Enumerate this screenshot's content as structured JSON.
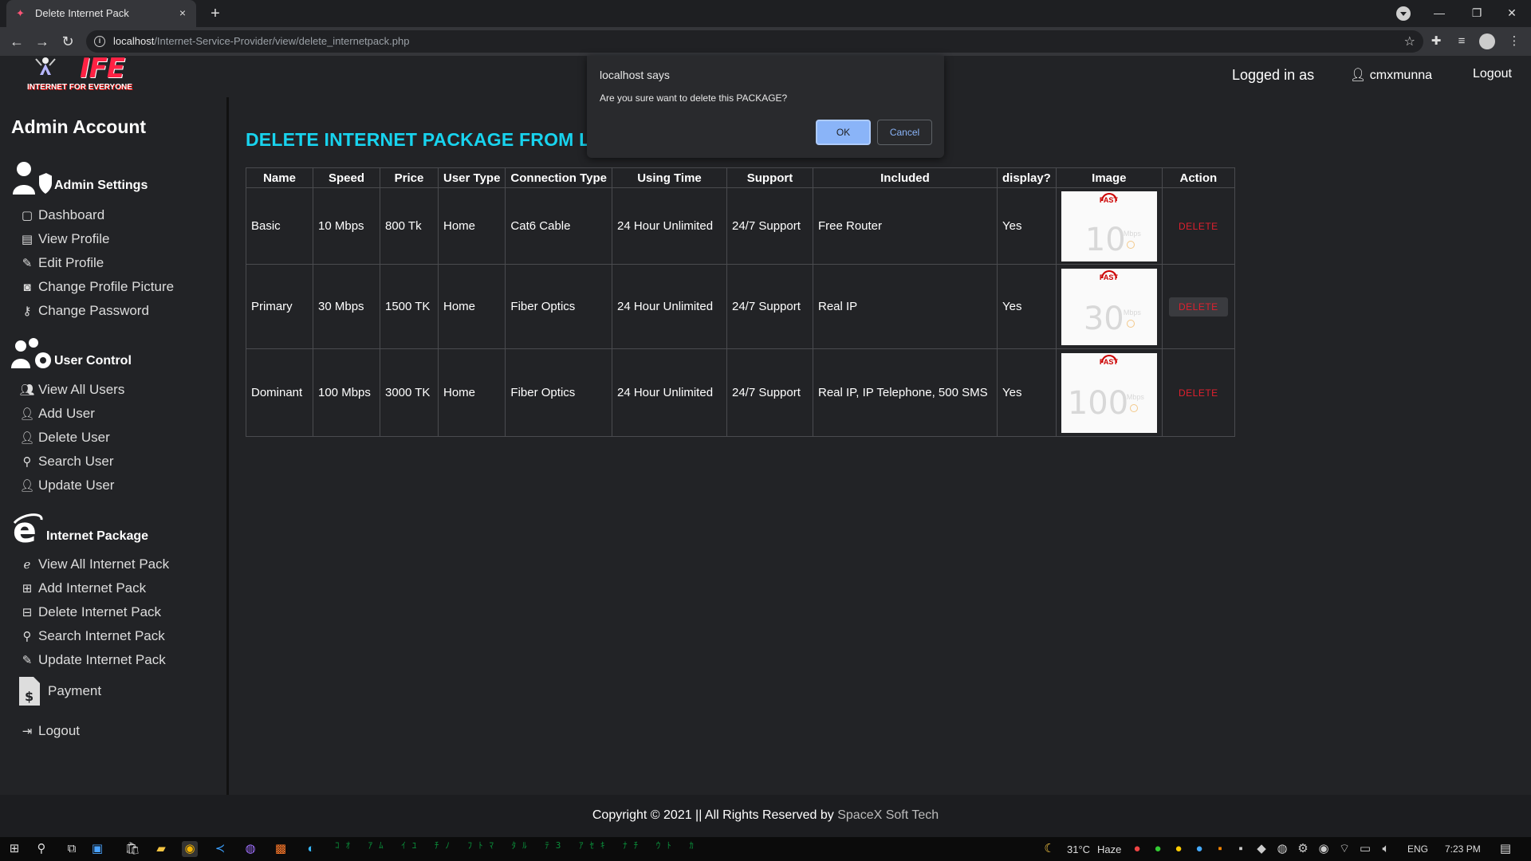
{
  "browser": {
    "tab_title": "Delete Internet Pack",
    "tab_close": "×",
    "new_tab": "+",
    "url_host": "localhost",
    "url_path": "/Internet-Service-Provider/view/delete_internetpack.php"
  },
  "logo": {
    "text": "IFE",
    "tagline": "INTERNET FOR EVERYONE"
  },
  "header": {
    "logged_in_label": "Logged in as",
    "username": "cmxmunna",
    "logout": "Logout"
  },
  "sidebar": {
    "title": "Admin Account",
    "sections": [
      {
        "label": "Admin Settings",
        "items": [
          "Dashboard",
          "View Profile",
          "Edit Profile",
          "Change Profile Picture",
          "Change Password"
        ]
      },
      {
        "label": "User Control",
        "items": [
          "View All Users",
          "Add User",
          "Delete User",
          "Search User",
          "Update User"
        ]
      },
      {
        "label": "Internet Package",
        "items": [
          "View All Internet Pack",
          "Add Internet Pack",
          "Delete Internet Pack",
          "Search Internet Pack",
          "Update Internet Pack"
        ]
      }
    ],
    "payment": "Payment",
    "logout": "Logout"
  },
  "main": {
    "title": "DELETE INTERNET PACKAGE FROM LIST",
    "table": {
      "headers": [
        "Name",
        "Speed",
        "Price",
        "User Type",
        "Connection Type",
        "Using Time",
        "Support",
        "Included",
        "display?",
        "Image",
        "Action"
      ],
      "rows": [
        {
          "name": "Basic",
          "speed": "10 Mbps",
          "price": "800 Tk",
          "user_type": "Home",
          "connection": "Cat6 Cable",
          "using_time": "24 Hour Unlimited",
          "support": "24/7 Support",
          "included": "Free Router",
          "display": "Yes",
          "image_speed": "10",
          "action": "DELETE"
        },
        {
          "name": "Primary",
          "speed": "30 Mbps",
          "price": "1500 TK",
          "user_type": "Home",
          "connection": "Fiber Optics",
          "using_time": "24 Hour Unlimited",
          "support": "24/7 Support",
          "included": "Real IP",
          "display": "Yes",
          "image_speed": "30",
          "action": "DELETE"
        },
        {
          "name": "Dominant",
          "speed": "100 Mbps",
          "price": "3000 TK",
          "user_type": "Home",
          "connection": "Fiber Optics",
          "using_time": "24 Hour Unlimited",
          "support": "24/7 Support",
          "included": "Real IP, IP Telephone, 500 SMS",
          "display": "Yes",
          "image_speed": "100",
          "action": "DELETE"
        }
      ],
      "image_brand": "FAST",
      "image_unit": "Mbps"
    }
  },
  "dialog": {
    "title": "localhost says",
    "message": "Are you sure want to delete this PACKAGE?",
    "ok": "OK",
    "cancel": "Cancel"
  },
  "footer": {
    "text": "Copyright © 2021 || All Rights Reserved by",
    "credit": "SpaceX Soft Tech"
  },
  "taskbar": {
    "weather_temp": "31°C",
    "weather_desc": "Haze",
    "language": "ENG",
    "time": "7:23 PM"
  },
  "colors": {
    "title_accent": "#18d3ee",
    "name_link": "#4cd9a8",
    "delete_red": "#e0202e",
    "dialog_ok": "#8ab4f8"
  }
}
